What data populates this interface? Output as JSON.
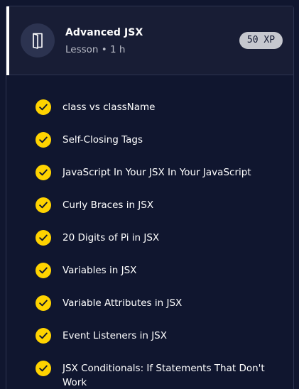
{
  "lesson": {
    "icon": "book-icon",
    "title": "Advanced JSX",
    "meta": "Lesson • 1 h",
    "xp": "50 XP"
  },
  "colors": {
    "background": "#10162f",
    "header": "#181d35",
    "check": "#ffd300",
    "xp_badge": "#c6c8cf"
  },
  "items": [
    {
      "label": "class vs className",
      "status": "completed"
    },
    {
      "label": "Self-Closing Tags",
      "status": "completed"
    },
    {
      "label": "JavaScript In Your JSX In Your JavaScript",
      "status": "completed"
    },
    {
      "label": "Curly Braces in JSX",
      "status": "completed"
    },
    {
      "label": "20 Digits of Pi in JSX",
      "status": "completed"
    },
    {
      "label": "Variables in JSX",
      "status": "completed"
    },
    {
      "label": "Variable Attributes in JSX",
      "status": "completed"
    },
    {
      "label": "Event Listeners in JSX",
      "status": "completed"
    },
    {
      "label": "JSX Conditionals: If Statements That Don't Work",
      "status": "completed"
    }
  ]
}
